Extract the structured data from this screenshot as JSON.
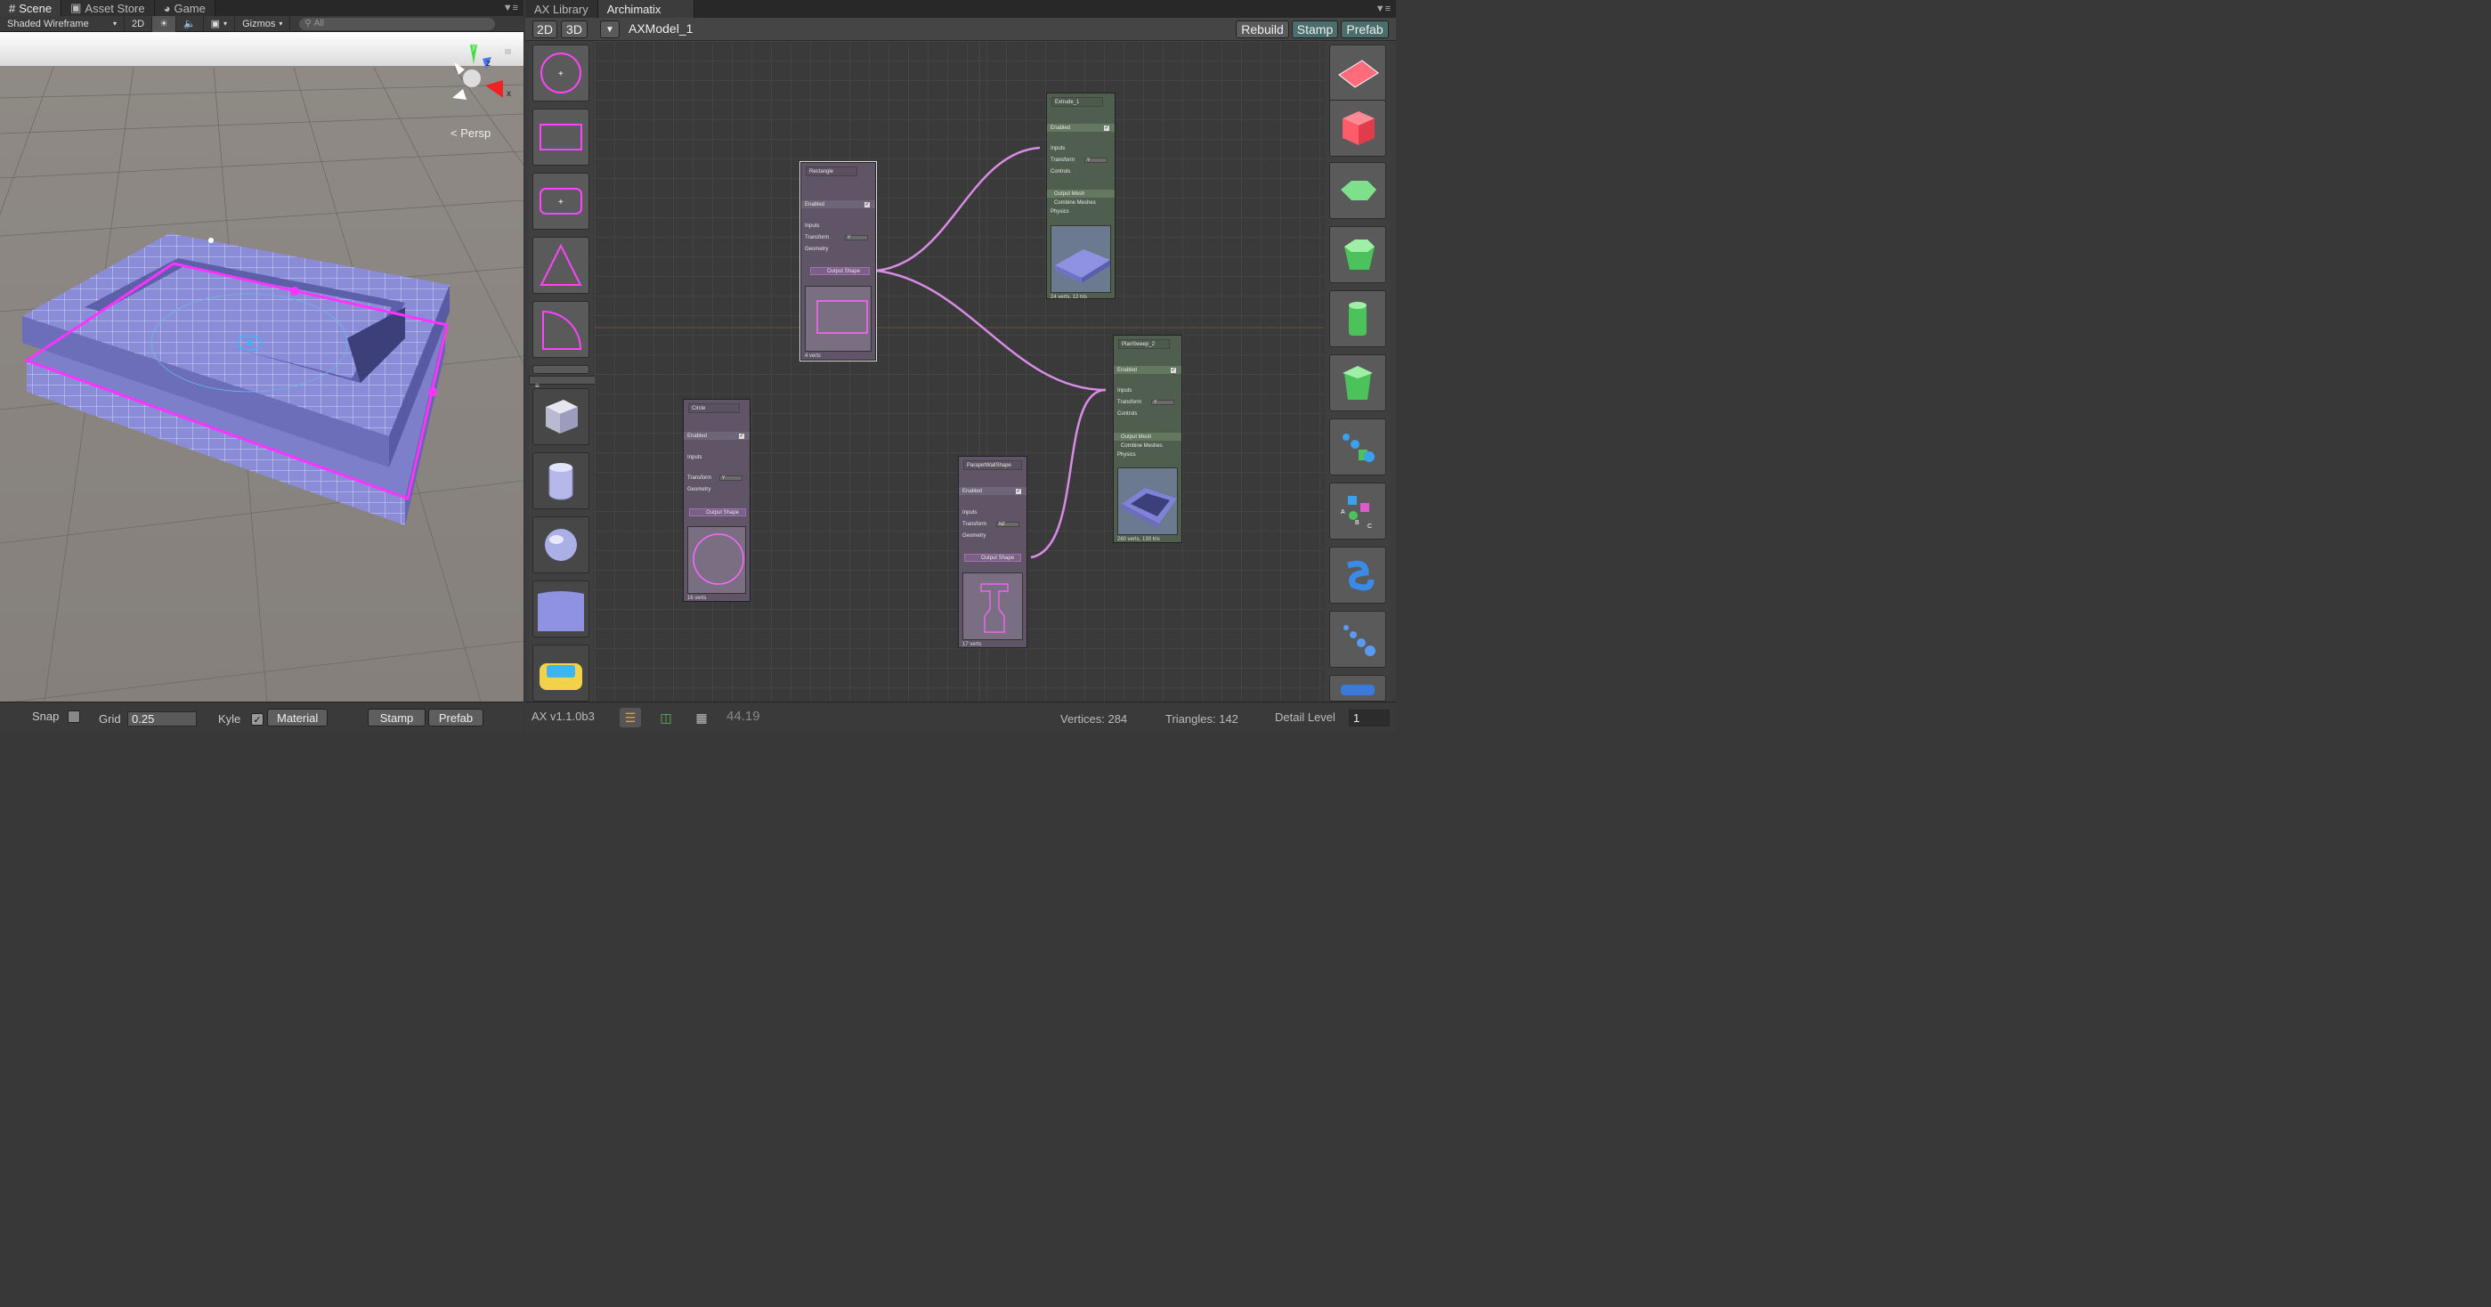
{
  "scene": {
    "tabs": [
      {
        "label": "Scene"
      },
      {
        "label": "Asset Store"
      },
      {
        "label": "Game"
      }
    ],
    "toolbar": {
      "shading": "Shaded Wireframe",
      "mode_2d": "2D",
      "gizmos": "Gizmos",
      "search_placeholder": "All"
    },
    "gizmo": {
      "y": "y",
      "z": "z",
      "x": "x",
      "persp": "Persp"
    },
    "bottom": {
      "snap": "Snap",
      "grid": "Grid",
      "grid_value": "0.25",
      "kyle": "Kyle",
      "material": "Material",
      "stamp": "Stamp",
      "prefab": "Prefab"
    }
  },
  "ax": {
    "tabs": [
      {
        "label": "AX Library"
      },
      {
        "label": "Archimatix"
      }
    ],
    "toolbar": {
      "btn_2d": "2D",
      "btn_3d": "3D",
      "model_name": "AXModel_1",
      "rebuild": "Rebuild",
      "stamp": "Stamp",
      "prefab": "Prefab"
    },
    "status": {
      "version": "AX v1.1.0b3",
      "zoom": "44.19",
      "vertices": "Vertices: 284",
      "triangles": "Triangles: 142",
      "detail_label": "Detail Level",
      "detail_value": "1"
    },
    "nodes": {
      "rectangle": {
        "title": "Rectangle",
        "enabled": "Enabled",
        "inputs": "Inputs",
        "transform": "Transform",
        "transform_val": "Y",
        "geometry": "Geometry",
        "output": "Output Shape",
        "foot": "4 verts"
      },
      "circle": {
        "title": "Circle",
        "enabled": "Enabled",
        "inputs": "Inputs",
        "transform": "Transform",
        "transform_val": "Y",
        "geometry": "Geometry",
        "output": "Output Shape",
        "foot": "16 verts"
      },
      "parapet": {
        "title": "ParapetWallShape",
        "enabled": "Enabled",
        "inputs": "Inputs",
        "transform": "Transform",
        "transform_val": "NZ",
        "geometry": "Geometry",
        "output": "Output Shape",
        "foot": "17 verts"
      },
      "extrude": {
        "title": "Extrude_1",
        "enabled": "Enabled",
        "inputs": "Inputs",
        "transform": "Transform",
        "transform_val": "Y",
        "controls": "Controls",
        "output": "Output Mesh",
        "combine": "Combine Meshes",
        "physics": "Physics",
        "foot": "24 verts, 12 tris"
      },
      "plansweep": {
        "title": "PlanSweep_2",
        "enabled": "Enabled",
        "inputs": "Inputs",
        "transform": "Transform",
        "transform_val": "Y",
        "controls": "Controls",
        "output": "Output Mesh",
        "combine": "Combine Meshes",
        "physics": "Physics",
        "foot": "260 verts, 130 tris"
      }
    }
  },
  "colors": {
    "accent_magenta": "#ff33ff",
    "wire_pink": "#d98ce6",
    "teal_button": "#4a6e6c",
    "node_purple": "#5f5566",
    "node_green": "#4f5e4f"
  }
}
